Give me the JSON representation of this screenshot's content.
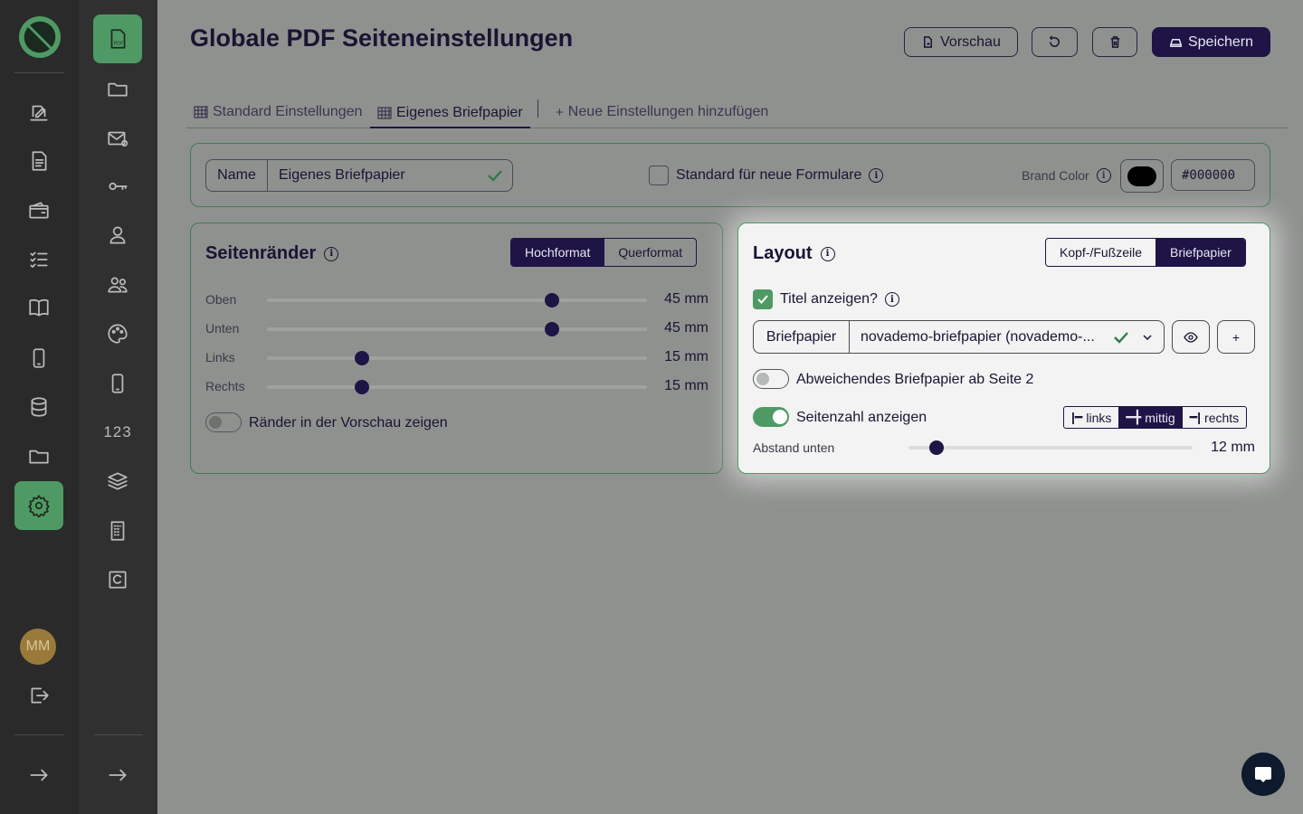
{
  "sidebar": {
    "user_initials": "MM",
    "rail2_text_item": "123",
    "items_rail1": [
      "logo-icon",
      "edit-icon",
      "document-icon",
      "wallet-icon",
      "checklist-icon",
      "book-icon",
      "mobile-icon",
      "database-icon",
      "folder-icon",
      "settings-icon",
      "logout-icon",
      "expand-icon"
    ],
    "items_rail2": [
      "pdf-icon",
      "folder-icon",
      "mail-icon",
      "key-icon",
      "user-icon",
      "users-icon",
      "palette-icon",
      "mobile-icon",
      "number-icon",
      "layers-icon",
      "building-icon",
      "c-icon",
      "expand-icon"
    ]
  },
  "header": {
    "title": "Globale PDF Seiteneinstellungen",
    "preview_label": "Vorschau",
    "save_label": "Speichern"
  },
  "tabs": {
    "items": [
      {
        "label": "Standard Einstellungen",
        "active": false
      },
      {
        "label": "Eigenes Briefpapier",
        "active": true
      },
      {
        "label": "Neue Einstellungen hinzufügen",
        "active": false
      }
    ]
  },
  "top_card": {
    "name_label": "Name",
    "name_value": "Eigenes Briefpapier",
    "default_label": "Standard für neue Formulare",
    "default_checked": false,
    "brand_color_label": "Brand Color",
    "brand_color_value": "#000000"
  },
  "margins_card": {
    "title": "Seitenränder",
    "orientation_options": [
      "Hochformat",
      "Querformat"
    ],
    "orientation_selected": "Hochformat",
    "rows": [
      {
        "label": "Oben",
        "value": 45,
        "display": "45 mm"
      },
      {
        "label": "Unten",
        "value": 45,
        "display": "45 mm"
      },
      {
        "label": "Links",
        "value": 15,
        "display": "15 mm"
      },
      {
        "label": "Rechts",
        "value": 15,
        "display": "15 mm"
      }
    ],
    "slider_max": 60,
    "show_margins_label": "Ränder in der Vorschau zeigen",
    "show_margins_on": false
  },
  "layout_card": {
    "title": "Layout",
    "mode_options": [
      "Kopf-/Fußzeile",
      "Briefpapier"
    ],
    "mode_selected": "Briefpapier",
    "show_title_label": "Titel anzeigen?",
    "show_title_checked": true,
    "letterhead_label": "Briefpapier",
    "letterhead_value": "novademo-briefpapier (novademo-...",
    "alt_letterhead_label": "Abweichendes Briefpapier ab Seite 2",
    "alt_letterhead_on": false,
    "page_number_label": "Seitenzahl anzeigen",
    "page_number_on": true,
    "alignment_options": [
      "links",
      "mittig",
      "rechts"
    ],
    "alignment_selected": "mittig",
    "bottom_distance_label": "Abstand unten",
    "bottom_distance_value": 12,
    "bottom_distance_display": "12 mm",
    "bottom_distance_max": 120
  },
  "colors": {
    "accent": "#4f9a64",
    "primary": "#1e1446",
    "rail_dark": "#2a2a2a"
  }
}
